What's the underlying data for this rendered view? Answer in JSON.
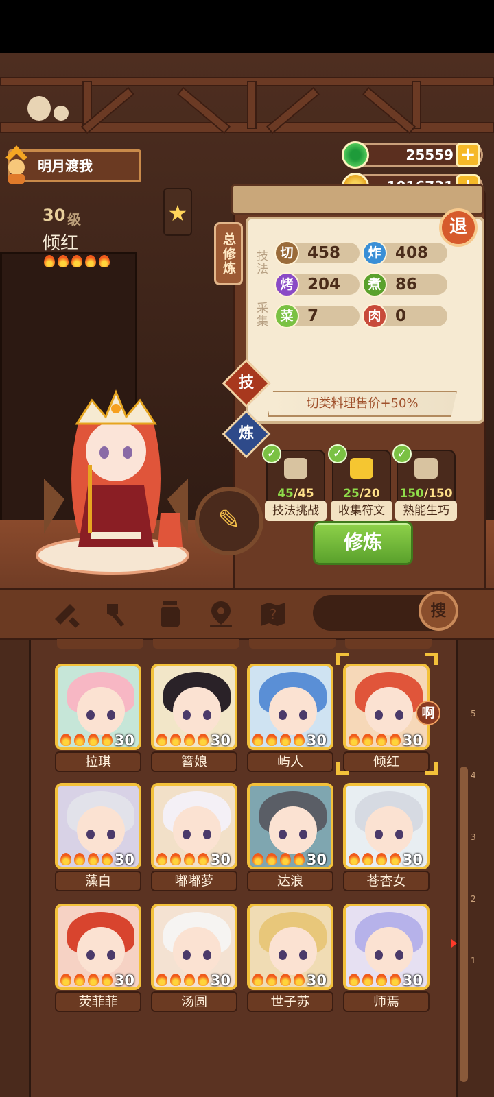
{
  "player": {
    "name": "明月渡我"
  },
  "currency": {
    "jade": "25559",
    "coins": "1016731",
    "plus": "+"
  },
  "character": {
    "level": "30",
    "level_unit": "级",
    "name": "倾红",
    "favorite_icon": "★"
  },
  "panel": {
    "total_tab": "总修炼",
    "back": "退",
    "section_skill": "技法",
    "section_gather": "采集",
    "stats": [
      {
        "icon": "切",
        "value": "458",
        "color": "#9a6b3a"
      },
      {
        "icon": "炸",
        "value": "408",
        "color": "#3a8fd6"
      },
      {
        "icon": "烤",
        "value": "204",
        "color": "#8a4ac6"
      },
      {
        "icon": "煮",
        "value": "86",
        "color": "#5aa12c"
      },
      {
        "icon": "菜",
        "value": "7",
        "color": "#7ac143"
      },
      {
        "icon": "肉",
        "value": "0",
        "color": "#c84a3a"
      }
    ],
    "tab_skill": "技",
    "tab_refine": "炼",
    "bonus": "切类料理售价+50%",
    "tasks": [
      {
        "done": "45",
        "total": "/45",
        "label": "技法挑战"
      },
      {
        "done": "25",
        "total": "/20",
        "label": "收集符文"
      },
      {
        "done": "150",
        "total": "/150",
        "label": "熟能生巧"
      }
    ],
    "check": "✓",
    "train_button": "修炼",
    "pen_icon": "✎"
  },
  "toolbar": {
    "search_label": "搜"
  },
  "roster": {
    "new_badge": "啊",
    "cards": [
      {
        "name": "拉琪",
        "level": "30",
        "hair": "#f7b7c4",
        "bg": "#c6e6d8"
      },
      {
        "name": "簪娘",
        "level": "30",
        "hair": "#2a2228",
        "bg": "#f2e6c8"
      },
      {
        "name": "屿人",
        "level": "30",
        "hair": "#5a8fd6",
        "bg": "#cfe3f2"
      },
      {
        "name": "倾红",
        "level": "30",
        "hair": "#e0553a",
        "bg": "#f6d8b8"
      },
      {
        "name": "藻白",
        "level": "30",
        "hair": "#e2e2ea",
        "bg": "#d8d2e6"
      },
      {
        "name": "嘟嘟萝",
        "level": "30",
        "hair": "#f4f0f6",
        "bg": "#f2e0c8"
      },
      {
        "name": "达浪",
        "level": "30",
        "hair": "#5a5e66",
        "bg": "#7fa6b0"
      },
      {
        "name": "苍杏女",
        "level": "30",
        "hair": "#d6dae2",
        "bg": "#e8eef2"
      },
      {
        "name": "荧菲菲",
        "level": "30",
        "hair": "#d8442e",
        "bg": "#f6d2c4"
      },
      {
        "name": "汤圆",
        "level": "30",
        "hair": "#f6f4f2",
        "bg": "#f4e2d2"
      },
      {
        "name": "世子苏",
        "level": "30",
        "hair": "#e8c77a",
        "bg": "#f0dcb4"
      },
      {
        "name": "师焉",
        "level": "30",
        "hair": "#b6b2ea",
        "bg": "#e6e0f2"
      }
    ]
  },
  "scroll_ticks": [
    "5",
    "4",
    "3",
    "2",
    "1"
  ]
}
